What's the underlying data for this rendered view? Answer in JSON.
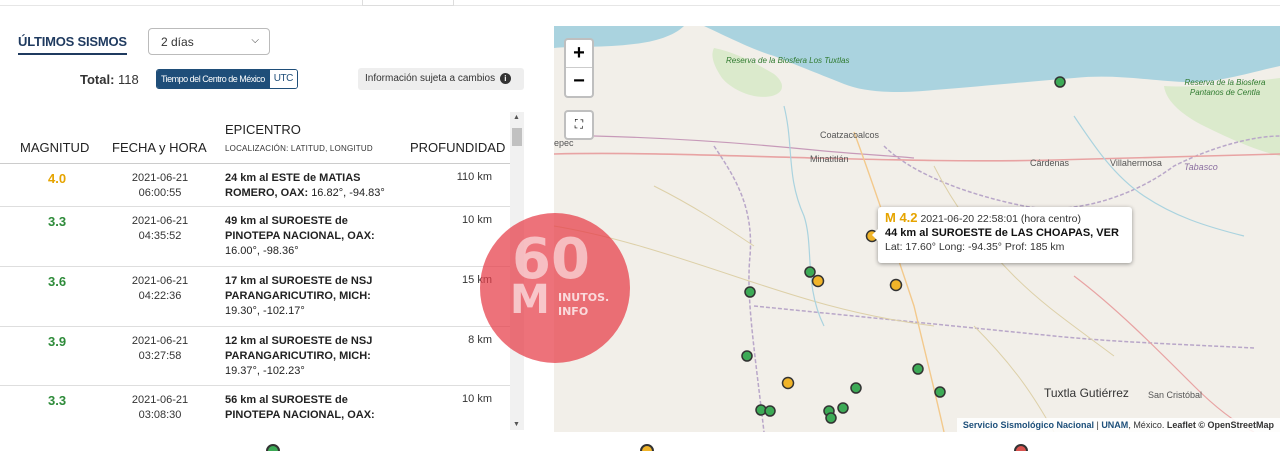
{
  "header": {
    "title": "ÚLTIMOS SISMOS",
    "period_select": "2 días"
  },
  "summary": {
    "total_label": "Total:",
    "total_value": "118",
    "tz_active": "Tiempo del Centro de México",
    "tz_other": "UTC",
    "notice": "Información sujeta a cambios"
  },
  "table": {
    "headers": {
      "magnitude": "MAGNITUD",
      "date": "FECHA y HORA",
      "epicenter": "EPICENTRO",
      "epicenter_sub": "LOCALIZACIÓN: LATITUD, LONGITUD",
      "depth": "PROFUNDIDAD"
    },
    "rows": [
      {
        "magnitude": "4.0",
        "mag_color": "#e6a400",
        "date": "2021-06-21",
        "time": "06:00:55",
        "distance": "24 km al ESTE de MATIAS",
        "place": "ROMERO, OAX:",
        "coords": "16.82°, -94.83°",
        "depth": "110 km"
      },
      {
        "magnitude": "3.3",
        "mag_color": "#2e8b3a",
        "date": "2021-06-21",
        "time": "04:35:52",
        "distance": "49 km al SUROESTE de",
        "place": "PINOTEPA NACIONAL, OAX:",
        "coords": "16.00°, -98.36°",
        "depth": "10 km"
      },
      {
        "magnitude": "3.6",
        "mag_color": "#2e8b3a",
        "date": "2021-06-21",
        "time": "04:22:36",
        "distance": "17 km al SUROESTE de NSJ",
        "place": "PARANGARICUTIRO, MICH:",
        "coords": "19.30°, -102.17°",
        "depth": "15 km"
      },
      {
        "magnitude": "3.9",
        "mag_color": "#2e8b3a",
        "date": "2021-06-21",
        "time": "03:27:58",
        "distance": "12 km al SUROESTE de NSJ",
        "place": "PARANGARICUTIRO, MICH:",
        "coords": "19.37°, -102.23°",
        "depth": "8 km"
      },
      {
        "magnitude": "3.3",
        "mag_color": "#2e8b3a",
        "date": "2021-06-21",
        "time": "03:08:30",
        "distance": "56 km al SUROESTE de",
        "place": "PINOTEPA NACIONAL, OAX:",
        "coords": "",
        "depth": "10 km"
      }
    ]
  },
  "map": {
    "zoom_in": "+",
    "zoom_out": "−",
    "labels": {
      "reserva1": "Reserva de la Biosfera Los Tuxtlas",
      "reserva2": "Reserva de la Biosfera Pantanos de Centla",
      "coatzacoalcos": "Coatzacoalcos",
      "minatitlan": "Minatitlán",
      "cardenas": "Cárdenas",
      "villahermosa": "Villahermosa",
      "tabasco": "Tabasco",
      "tuxtla": "Tuxtla Gutiérrez",
      "san_cristobal": "San Cristóbal",
      "cut_left": "epec"
    },
    "tooltip": {
      "magnitude": "M 4.2",
      "datetime": "2021-06-20  22:58:01 (hora centro)",
      "location": "44 km al SUROESTE de LAS CHOAPAS, VER",
      "details": "Lat: 17.60°  Long: -94.35°  Prof: 185 km"
    },
    "attribution": {
      "source": "Servicio Sismológico Nacional",
      "sep": " | ",
      "org": "UNAM",
      "rest": ", México. ",
      "leaflet": "Leaflet",
      "osm": " © OpenStreetMap"
    },
    "marker_colors": {
      "green": "#3daa56",
      "orange": "#f0b429"
    }
  },
  "watermark": {
    "l60": "60",
    "lm": "M",
    "lt1": "INUTOS.",
    "lt2": "INFO"
  }
}
